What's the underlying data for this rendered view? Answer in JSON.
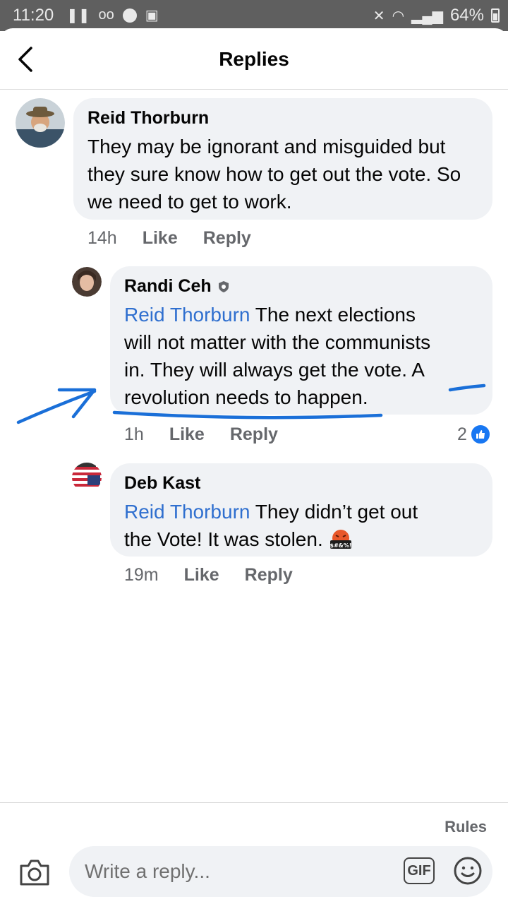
{
  "status_bar": {
    "time": "11:20",
    "battery": "64%"
  },
  "header": {
    "title": "Replies"
  },
  "comments": [
    {
      "author": "Reid Thorburn",
      "text": "They may be ignorant and misguided but they sure know how to get out the vote. So we need to get to work.",
      "time": "14h",
      "like": "Like",
      "reply": "Reply"
    },
    {
      "author": "Randi Ceh",
      "mention": "Reid Thorburn",
      "text_line1": "The next elections",
      "text_line2": "will not matter with the communists",
      "text_line3": "in.  They will always get the vote.  A",
      "text_line4": "revolution needs to happen.",
      "time": "1h",
      "like": "Like",
      "reply": "Reply",
      "reaction_count": "2"
    },
    {
      "author": "Deb Kast",
      "mention": "Reid Thorburn",
      "text_line1": "They didn’t get out",
      "text_line2": "the Vote!   It was stolen.",
      "emoji_label": "$#&%!",
      "time": "19m",
      "like": "Like",
      "reply": "Reply"
    }
  ],
  "footer": {
    "rules": "Rules",
    "reply_placeholder": "Write a reply...",
    "gif": "GIF"
  },
  "colors": {
    "mention": "#2f6fcf",
    "annotation_ink": "#1a6fd8",
    "bubble": "#f0f2f5",
    "status_bar": "#5f5f5f"
  }
}
